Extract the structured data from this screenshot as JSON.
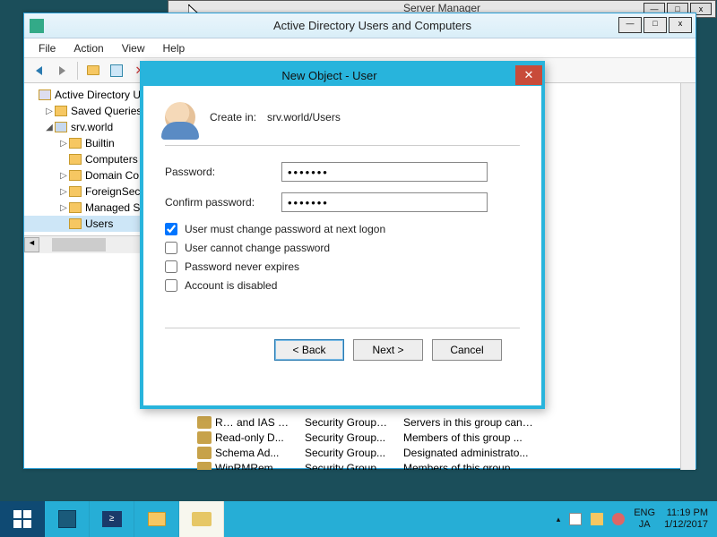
{
  "server_manager": {
    "title": "Server Manager"
  },
  "aduc": {
    "title": "Active Directory Users and Computers",
    "menu": {
      "file": "File",
      "action": "Action",
      "view": "View",
      "help": "Help"
    },
    "tree": {
      "root": "Active Directory Us",
      "saved": "Saved Queries",
      "domain": "srv.world",
      "builtin": "Builtin",
      "computers": "Computers",
      "domaincontrollers": "Domain Co",
      "foreign": "ForeignSecu",
      "managed": "Managed Se",
      "users": "Users"
    },
    "list": [
      {
        "name": "R… and IAS …",
        "type": "Security Group…",
        "desc": "Servers in this group can…"
      },
      {
        "name": "Read-only D...",
        "type": "Security Group...",
        "desc": "Members of this group ..."
      },
      {
        "name": "Schema Ad...",
        "type": "Security Group...",
        "desc": "Designated administrato..."
      },
      {
        "name": "WinRMRem...",
        "type": "Security Group...",
        "desc": "Members of this group ..."
      }
    ]
  },
  "dialog": {
    "title": "New Object - User",
    "create_in_label": "Create in:",
    "create_in_path": "srv.world/Users",
    "password_label": "Password:",
    "confirm_label": "Confirm password:",
    "password_value": "•••••••",
    "confirm_value": "•••••••",
    "chk_must_change": "User must change password at next logon",
    "chk_cannot_change": "User cannot change password",
    "chk_never_expires": "Password never expires",
    "chk_disabled": "Account is disabled",
    "chk_must_change_checked": true,
    "back": "< Back",
    "next": "Next >",
    "cancel": "Cancel"
  },
  "taskbar": {
    "lang1": "ENG",
    "lang2": "JA",
    "time": "11:19 PM",
    "date": "1/12/2017"
  }
}
